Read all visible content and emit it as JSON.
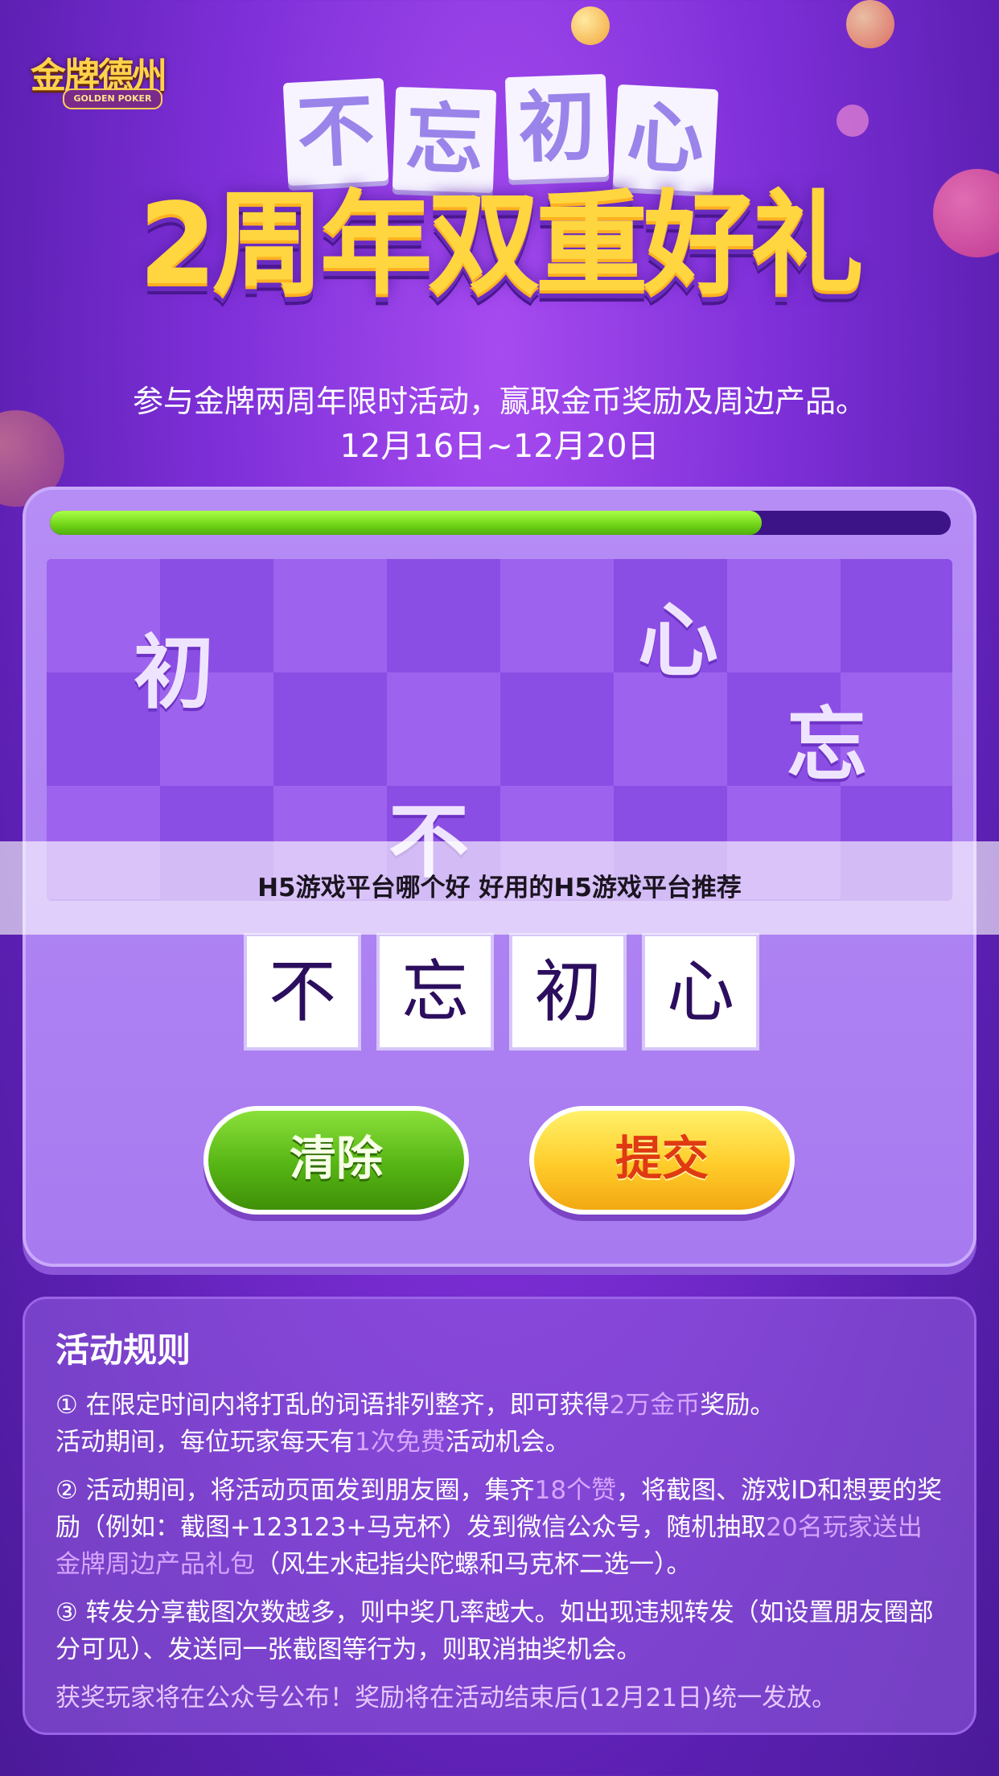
{
  "logo": {
    "text": "金牌德州",
    "sub": "GOLDEN POKER"
  },
  "title_tiles": [
    "不",
    "忘",
    "初",
    "心"
  ],
  "headline": "2周年双重好礼",
  "intro": "参与金牌两周年限时活动，赢取金币奖励及周边产品。",
  "dates": "12月16日~12月20日",
  "progress_percent": 79,
  "scrambled_chars": [
    "初",
    "心",
    "忘",
    "不"
  ],
  "answer_chars": [
    "不",
    "忘",
    "初",
    "心"
  ],
  "buttons": {
    "clear": "清除",
    "submit": "提交"
  },
  "overlay_text": "H5游戏平台哪个好 好用的H5游戏平台推荐",
  "rules": {
    "title": "活动规则",
    "r1_a": "① 在限定时间内将打乱的词语排列整齐，即可获得",
    "r1_hl": "2万金币",
    "r1_b": "奖励。",
    "r1_c": "活动期间，每位玩家每天有",
    "r1_hl2": "1次免费",
    "r1_d": "活动机会。",
    "r2_a": "② 活动期间，将活动页面发到朋友圈，集齐",
    "r2_hl": "18个赞",
    "r2_b": "，将截图、游戏ID和想要的奖励（例如：截图+123123+马克杯）发到微信公众号，随机抽取",
    "r2_hl2": "20名玩家送出金牌周边产品礼包",
    "r2_c": "（风生水起指尖陀螺和马克杯二选一）。",
    "r3": "③ 转发分享截图次数越多，则中奖几率越大。如出现违规转发（如设置朋友圈部分可见）、发送同一张截图等行为，则取消抽奖机会。",
    "footer": "获奖玩家将在公众号公布！奖励将在活动结束后(12月21日)统一发放。"
  }
}
